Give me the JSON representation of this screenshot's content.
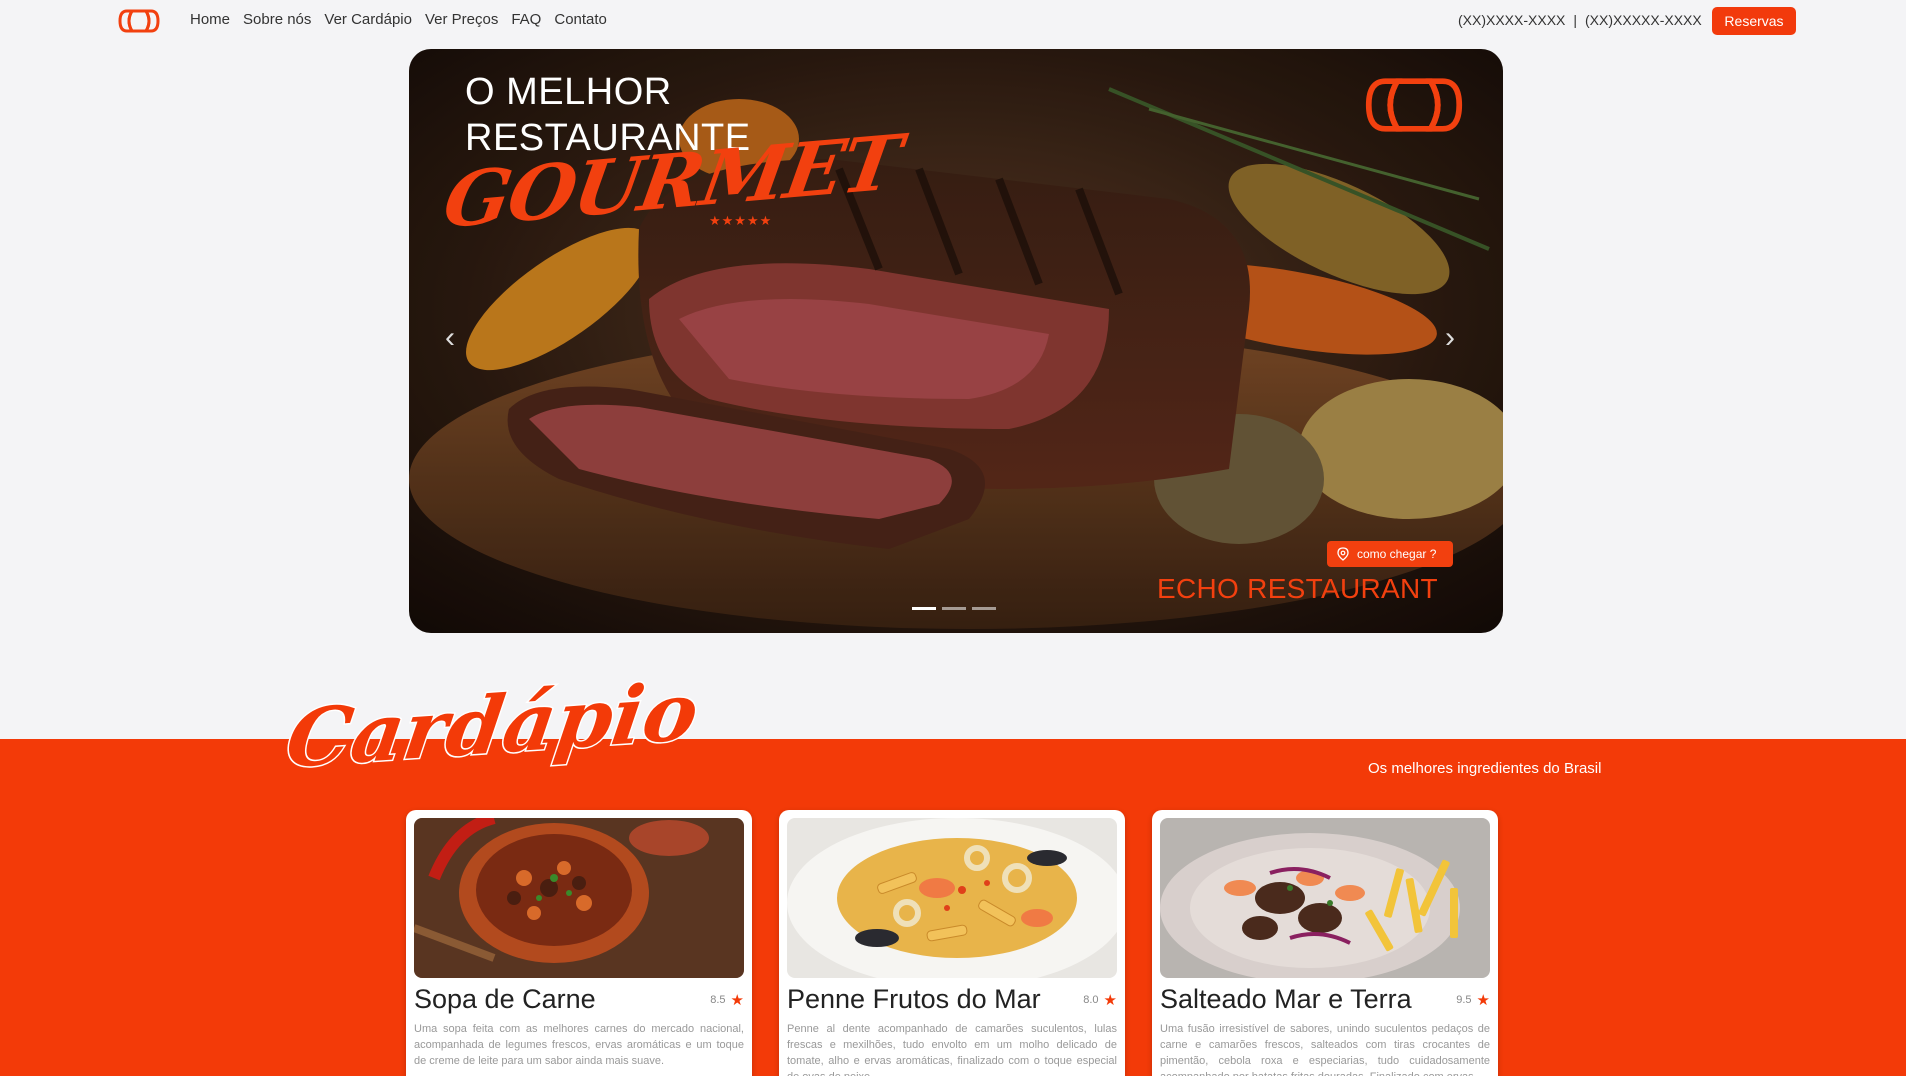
{
  "nav": {
    "links": [
      "Home",
      "Sobre nós",
      "Ver Cardápio",
      "Ver Preços",
      "FAQ",
      "Contato"
    ],
    "phone1": "(XX)XXXX-XXXX",
    "separator": "|",
    "phone2": "(XX)XXXXX-XXXX",
    "reserve_label": "Reservas"
  },
  "hero": {
    "line1": "O MELHOR",
    "line2": "RESTAURANTE",
    "script": "GOURMET",
    "stars": "★★★★★",
    "how_to_label": "como chegar ?",
    "brand": "ECHO RESTAURANT",
    "slides": 3,
    "active_slide": 0
  },
  "menu": {
    "title": "Cardápio",
    "subtitle": "Os melhores ingredientes do Brasil",
    "items": [
      {
        "name": "Sopa de Carne",
        "rating": "8.5",
        "desc": "Uma sopa feita com as melhores carnes do mercado nacional, acompanhada de legumes frescos, ervas aromáticas e um toque de creme de leite para um sabor ainda mais suave."
      },
      {
        "name": "Penne Frutos do Mar",
        "rating": "8.0",
        "desc": "Penne al dente acompanhado de camarões suculentos, lulas frescas e mexilhões, tudo envolto em um molho delicado de tomate, alho e ervas aromáticas, finalizado com o toque especial de ovas de peixe."
      },
      {
        "name": "Salteado Mar e Terra",
        "rating": "9.5",
        "desc": "Uma fusão irresistível de sabores, unindo suculentos pedaços de carne e camarões frescos, salteados com tiras crocantes de pimentão, cebola roxa e especiarias, tudo cuidadosamente acompanhado por batatas fritas douradas. Finalizado com ervas"
      }
    ]
  },
  "colors": {
    "accent": "#f23a0c",
    "background": "#f4f4f6"
  }
}
